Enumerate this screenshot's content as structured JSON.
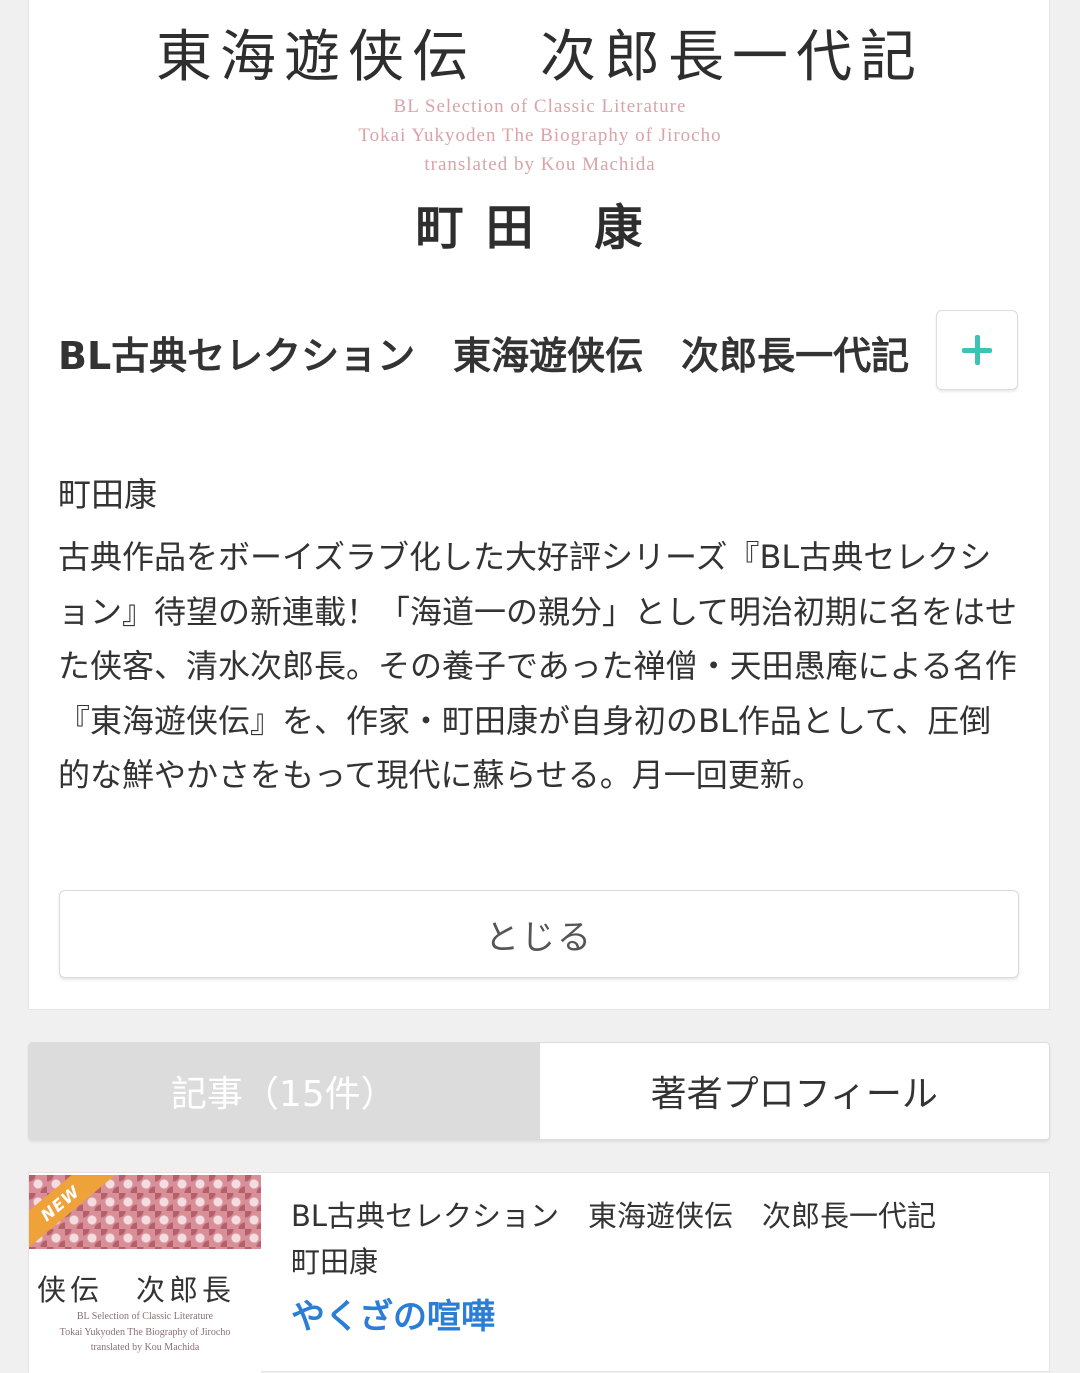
{
  "cover": {
    "title": "東海遊侠伝　次郎長一代記",
    "sub_line1": "BL Selection of Classic Literature",
    "sub_line2": "Tokai Yukyoden  The Biography of Jirocho",
    "sub_line3": "translated by Kou Machida",
    "author": "町田 康"
  },
  "series": {
    "title": "BL古典セレクション　東海遊侠伝　次郎長一代記",
    "add_icon": "plus-icon",
    "author": "町田康",
    "description": "古典作品をボーイズラブ化した大好評シリーズ『BL古典セレクション』待望の新連載！「海道一の親分」として明治初期に名をはせた侠客、清水次郎長。その養子であった禅僧・天田愚庵による名作『東海遊侠伝』を、作家・町田康が自身初のBL作品として、圧倒的な鮮やかさをもって現代に蘇らせる。月一回更新。",
    "close_label": "とじる"
  },
  "tabs": {
    "articles_label": "記事（15件）",
    "profile_label": "著者プロフィール"
  },
  "article": {
    "badge": "NEW",
    "thumb_title": "侠伝　次郎長",
    "thumb_sub1": "BL Selection of Classic Literature",
    "thumb_sub2": "Tokai Yukyoden  The Biography of Jirocho",
    "thumb_sub3": "translated by Kou Machida",
    "series": "BL古典セレクション　東海遊侠伝　次郎長一代記",
    "author": "町田康",
    "title": "やくざの喧嘩"
  },
  "colors": {
    "accent_teal": "#3cc3b4",
    "link_blue": "#2a7ed6",
    "cover_pink": "#d9a3a9",
    "new_badge": "#f0a23a"
  }
}
